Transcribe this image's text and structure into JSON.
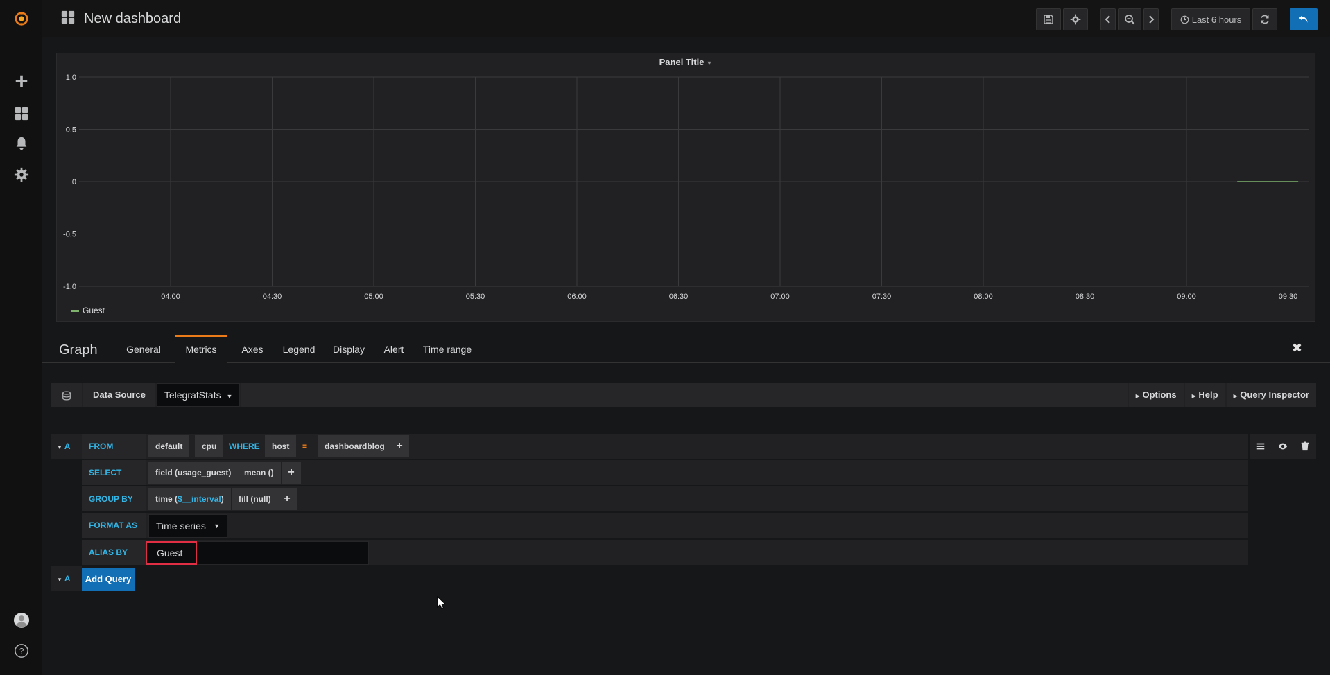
{
  "app": {
    "name": "Grafana"
  },
  "colors": {
    "accent": "#eb7b18",
    "keyword": "#33b5e5",
    "primary_button": "#126eb5",
    "highlight_box": "#e02f44",
    "series": "#7eb26d"
  },
  "sidebar": {
    "items": [
      {
        "icon": "grafana-logo-icon"
      },
      {
        "icon": "plus-icon"
      },
      {
        "icon": "dashboards-icon"
      },
      {
        "icon": "bell-icon"
      },
      {
        "icon": "gear-icon"
      },
      {
        "icon": "user-avatar-icon"
      },
      {
        "icon": "help-icon"
      }
    ]
  },
  "topnav": {
    "title": "New dashboard",
    "time_range": "Last 6 hours"
  },
  "panel": {
    "title": "Panel Title",
    "legend": [
      "Guest"
    ]
  },
  "chart_data": {
    "type": "line",
    "title": "Panel Title",
    "x_ticks": [
      "04:00",
      "04:30",
      "05:00",
      "05:30",
      "06:00",
      "06:30",
      "07:00",
      "07:30",
      "08:00",
      "08:30",
      "09:00",
      "09:30"
    ],
    "y_ticks": [
      "1.0",
      "0.5",
      "0",
      "-0.5",
      "-1.0"
    ],
    "ylim": [
      -1.0,
      1.0
    ],
    "grid": true,
    "legend_position": "bottom-left",
    "series": [
      {
        "name": "Guest",
        "color": "#7eb26d",
        "x": [
          "09:15",
          "09:33"
        ],
        "y": [
          0,
          0
        ]
      }
    ]
  },
  "editor": {
    "panel_type": "Graph",
    "tabs": [
      "General",
      "Metrics",
      "Axes",
      "Legend",
      "Display",
      "Alert",
      "Time range"
    ],
    "active_tab": "Metrics",
    "datasource_label": "Data Source",
    "datasource_value": "TelegrafStats",
    "options_btn": "Options",
    "help_btn": "Help",
    "inspector_btn": "Query Inspector"
  },
  "query": {
    "ref_id": "A",
    "from_label": "FROM",
    "from_policy": "default",
    "from_measurement": "cpu",
    "where_label": "WHERE",
    "where_key": "host",
    "where_op": "=",
    "where_value": "dashboardblog",
    "select_label": "SELECT",
    "select_field": "field (usage_guest)",
    "select_fn": "mean ()",
    "group_label": "GROUP BY",
    "group_time_prefix": "time (",
    "group_time_var": "$__interval",
    "group_time_suffix": ")",
    "group_fill": "fill (null)",
    "format_label": "FORMAT AS",
    "format_value": "Time series",
    "alias_label": "ALIAS BY",
    "alias_value": "Guest",
    "plus": "+"
  },
  "add_query": {
    "ref_id": "A",
    "label": "Add Query"
  }
}
